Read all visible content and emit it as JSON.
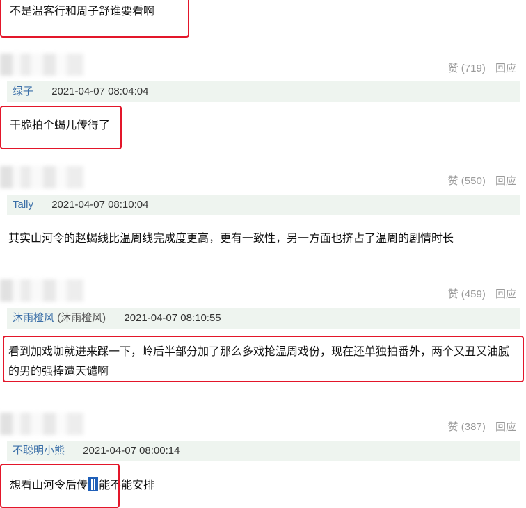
{
  "comments": [
    {
      "id": "c0",
      "text": "不是温客行和周子舒谁要看啊"
    },
    {
      "id": "c1",
      "likes_label": "赞 (719)",
      "reply_label": "回应",
      "author": "绿子",
      "author_sub": "",
      "time": "2021-04-07 08:04:04",
      "text": "干脆拍个蝎儿传得了"
    },
    {
      "id": "c2",
      "likes_label": "赞 (550)",
      "reply_label": "回应",
      "author": "Tally",
      "author_sub": "",
      "time": "2021-04-07 08:10:04",
      "text": "其实山河令的赵蝎线比温周线完成度更高，更有一致性，另一方面也挤占了温周的剧情时长"
    },
    {
      "id": "c3",
      "likes_label": "赞 (459)",
      "reply_label": "回应",
      "author": "沐雨橙风",
      "author_sub": "(沐雨橙风)",
      "time": "2021-04-07 08:10:55",
      "text": "看到加戏咖就进来踩一下，岭后半部分加了那么多戏抢温周戏份，现在还单独拍番外，两个又丑又油腻的男的强捧遭天谴啊"
    },
    {
      "id": "c4",
      "likes_label": "赞 (387)",
      "reply_label": "回应",
      "author": "不聪明小熊",
      "author_sub": "",
      "time": "2021-04-07 08:00:14",
      "text_before": "想看山河令后传",
      "text_after": "能不能安排"
    }
  ]
}
